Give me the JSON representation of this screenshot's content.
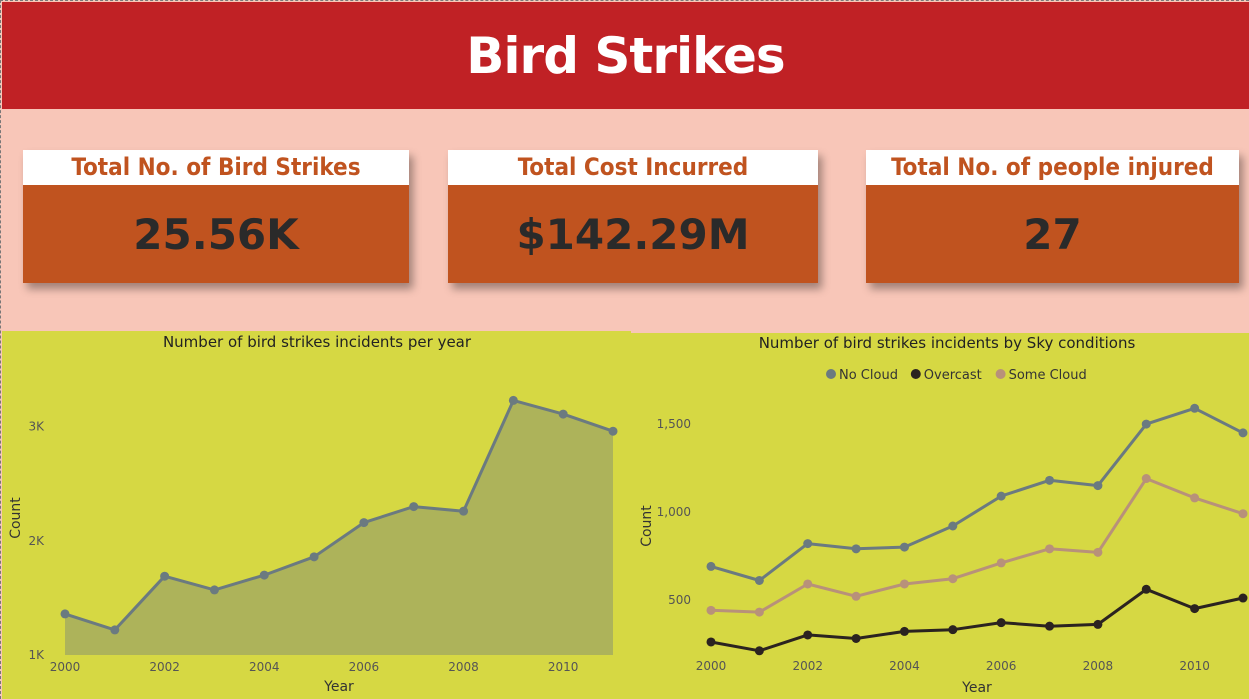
{
  "header": {
    "title": "Bird Strikes"
  },
  "kpis": [
    {
      "label": "Total No. of Bird Strikes",
      "value": "25.56K"
    },
    {
      "label": "Total Cost Incurred",
      "value": "$142.29M"
    },
    {
      "label": "Total No. of people injured",
      "value": "27"
    }
  ],
  "colors": {
    "header_bg": "#c02125",
    "kpi_band_bg": "#f8c6b8",
    "kpi_value_bg": "#c0531f",
    "chart_bg": "#d6d843",
    "area_fill": "#adb35a",
    "no_cloud": "#6b7a80",
    "overcast": "#2b2320",
    "some_cloud": "#b8917a"
  },
  "chart_data": [
    {
      "type": "area",
      "title": "Number of bird strikes incidents per year",
      "xlabel": "Year",
      "ylabel": "Count",
      "x": [
        2000,
        2001,
        2002,
        2003,
        2004,
        2005,
        2006,
        2007,
        2008,
        2009,
        2010,
        2011
      ],
      "x_ticks": [
        "2000",
        "2002",
        "2004",
        "2006",
        "2008",
        "2010"
      ],
      "y_ticks": [
        "1K",
        "2K",
        "3K"
      ],
      "ylim": [
        1000,
        3400
      ],
      "xlim": [
        2000,
        2011
      ],
      "series": [
        {
          "values": [
            1360,
            1220,
            1690,
            1570,
            1700,
            1860,
            2160,
            2300,
            2260,
            3230,
            3110,
            2960
          ]
        }
      ],
      "grid": false
    },
    {
      "type": "line",
      "title": "Number of bird strikes incidents by Sky conditions",
      "xlabel": "Year",
      "ylabel": "Count",
      "legend_position": "top",
      "x": [
        2000,
        2001,
        2002,
        2003,
        2004,
        2005,
        2006,
        2007,
        2008,
        2009,
        2010,
        2011
      ],
      "x_ticks": [
        "2000",
        "2002",
        "2004",
        "2006",
        "2008",
        "2010"
      ],
      "y_ticks": [
        "500",
        "1,000",
        "1,500"
      ],
      "ylim": [
        220,
        1620
      ],
      "xlim": [
        2000,
        2011
      ],
      "series": [
        {
          "name": "No Cloud",
          "values": [
            690,
            610,
            820,
            790,
            800,
            920,
            1090,
            1180,
            1150,
            1500,
            1590,
            1450
          ]
        },
        {
          "name": "Overcast",
          "values": [
            260,
            210,
            300,
            280,
            320,
            330,
            370,
            350,
            360,
            560,
            450,
            510
          ]
        },
        {
          "name": "Some Cloud",
          "values": [
            440,
            430,
            590,
            520,
            590,
            620,
            710,
            790,
            770,
            1190,
            1080,
            990
          ]
        }
      ],
      "grid": false
    }
  ]
}
